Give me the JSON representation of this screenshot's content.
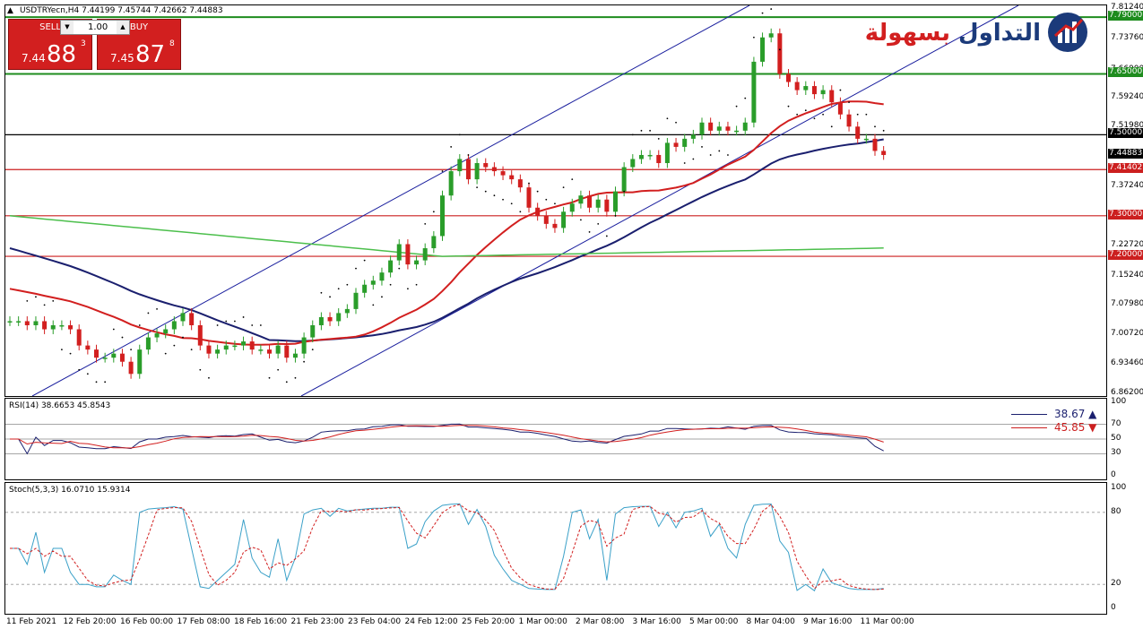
{
  "window": {
    "title": "USDTRYecn,H4  7.44199 7.45744 7.42662 7.44883"
  },
  "trade_panel": {
    "sell_label": "SELL",
    "buy_label": "BUY",
    "lot": "1.00",
    "sell_small": "7.44",
    "sell_big": "88",
    "sell_sup": "3",
    "buy_small": "7.45",
    "buy_big": "87",
    "buy_sup": "8"
  },
  "logo": {
    "text_blue": "التداول",
    "text_red": "بسهولة"
  },
  "indicators": {
    "rsi_title": "RSI(14) 38.6653 45.8543",
    "rsi_legend_1": "38.67 ▲",
    "rsi_legend_2": "45.85 ▼",
    "stoch_title": "Stoch(5,3,3) 16.0710 15.9314"
  },
  "colors": {
    "bull": "#2a9d2a",
    "bear": "#d21f1f",
    "ma_slow": "#1a1f6e",
    "ma_mid": "#d21f1f",
    "ma_green": "#4cbf4c",
    "channel": "#1a1f9e",
    "hline_green": "#1e8c1e",
    "hline_red": "#cc1f1f"
  },
  "price_axis": [
    "7.81240",
    "7.73760",
    "7.66000",
    "7.59240",
    "7.51980",
    "7.37240",
    "7.22720",
    "7.15240",
    "7.07980",
    "7.00720",
    "6.93460",
    "6.86200"
  ],
  "price_tags": [
    {
      "text": "7.79000",
      "color": "#1e8c1e"
    },
    {
      "text": "7.65000",
      "color": "#1e8c1e"
    },
    {
      "text": "7.50000",
      "color": "#000000"
    },
    {
      "text": "7.44883",
      "color": "#000000"
    },
    {
      "text": "7.41402",
      "color": "#cc1f1f"
    },
    {
      "text": "7.30000",
      "color": "#cc1f1f"
    },
    {
      "text": "7.20000",
      "color": "#cc1f1f"
    }
  ],
  "rsi_axis": [
    "100",
    "70",
    "50",
    "30",
    "0"
  ],
  "stoch_axis": [
    "100",
    "80",
    "20",
    "0"
  ],
  "date_axis": [
    "11 Feb 2021",
    "12 Feb 20:00",
    "16 Feb 00:00",
    "17 Feb 08:00",
    "18 Feb 16:00",
    "21 Feb 23:00",
    "23 Feb 04:00",
    "24 Feb 12:00",
    "25 Feb 20:00",
    "1 Mar 00:00",
    "2 Mar 08:00",
    "3 Mar 16:00",
    "5 Mar 00:00",
    "8 Mar 04:00",
    "9 Mar 16:00",
    "11 Mar 00:00"
  ],
  "chart_data": {
    "type": "line",
    "title": "USDTRYecn,H4",
    "ylim": [
      6.862,
      7.8124
    ],
    "horizontal_levels": [
      7.79,
      7.65,
      7.5,
      7.41402,
      7.3,
      7.2
    ],
    "last_price": 7.44883,
    "candles_close": [
      7.04,
      7.04,
      7.03,
      7.04,
      7.02,
      7.03,
      7.03,
      7.02,
      6.98,
      6.97,
      6.95,
      6.95,
      6.96,
      6.94,
      6.91,
      6.97,
      7.0,
      7.01,
      7.02,
      7.04,
      7.06,
      7.03,
      6.98,
      6.96,
      6.97,
      6.98,
      6.98,
      6.99,
      6.97,
      6.97,
      6.96,
      6.98,
      6.95,
      6.96,
      7.0,
      7.03,
      7.05,
      7.04,
      7.06,
      7.07,
      7.11,
      7.13,
      7.14,
      7.16,
      7.19,
      7.23,
      7.18,
      7.19,
      7.22,
      7.25,
      7.35,
      7.41,
      7.44,
      7.39,
      7.43,
      7.42,
      7.41,
      7.4,
      7.39,
      7.37,
      7.32,
      7.3,
      7.28,
      7.27,
      7.31,
      7.33,
      7.35,
      7.32,
      7.34,
      7.31,
      7.36,
      7.42,
      7.44,
      7.45,
      7.45,
      7.43,
      7.48,
      7.47,
      7.49,
      7.5,
      7.53,
      7.51,
      7.52,
      7.51,
      7.51,
      7.53,
      7.68,
      7.74,
      7.75,
      7.65,
      7.63,
      7.61,
      7.62,
      7.6,
      7.61,
      7.58,
      7.55,
      7.52,
      7.49,
      7.49,
      7.46,
      7.45
    ],
    "series": [
      {
        "name": "RSI(14)",
        "last": 38.6653
      },
      {
        "name": "Stoch(5,3,3)",
        "last": 16.071
      }
    ]
  }
}
